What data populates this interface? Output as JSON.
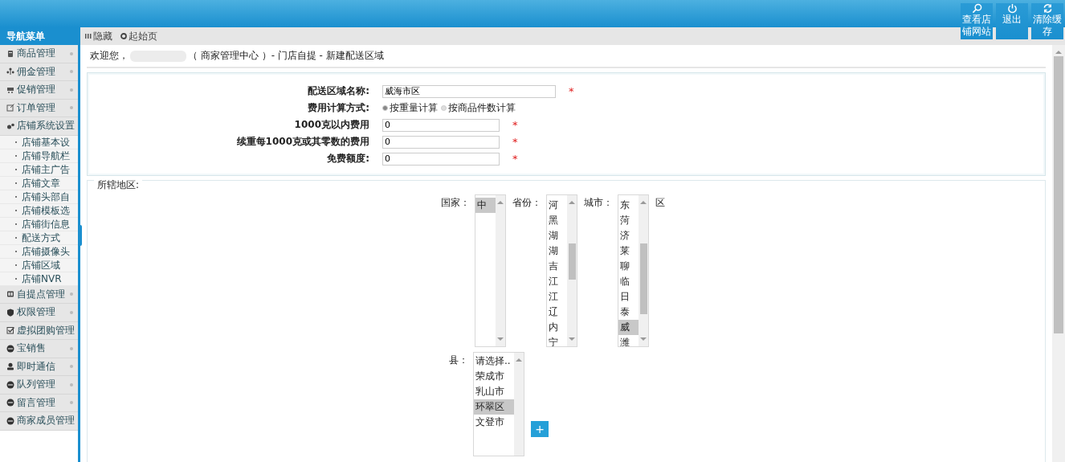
{
  "header": {
    "actions": [
      {
        "label": "查看店铺网站",
        "kind": "search"
      },
      {
        "label": "退出",
        "kind": "power"
      },
      {
        "label": "清除缓存",
        "kind": "refresh"
      }
    ]
  },
  "sidebar": {
    "title": "导航菜单",
    "items": [
      {
        "label": "商品管理",
        "kind": "jar",
        "expanded": false
      },
      {
        "label": "佣金管理",
        "kind": "tree",
        "expanded": false
      },
      {
        "label": "促销管理",
        "kind": "cart",
        "expanded": false
      },
      {
        "label": "订单管理",
        "kind": "edit",
        "expanded": false
      },
      {
        "label": "店铺系统设置",
        "kind": "gears",
        "expanded": true,
        "children": [
          "店铺基本设",
          "店铺导航栏",
          "店铺主广告",
          "店铺文章",
          "店铺头部自",
          "店铺模板选",
          "店铺街信息",
          "配送方式",
          "店铺摄像头",
          "店铺区域",
          "店铺NVR"
        ]
      },
      {
        "label": "自提点管理",
        "kind": "book",
        "expanded": false
      },
      {
        "label": "权限管理",
        "kind": "shield",
        "expanded": false
      },
      {
        "label": "虚拟团购管理",
        "kind": "check",
        "expanded": false
      },
      {
        "label": "宝销售",
        "kind": "minus",
        "expanded": false
      },
      {
        "label": "即时通信",
        "kind": "person",
        "expanded": false
      },
      {
        "label": "队列管理",
        "kind": "minus",
        "expanded": false
      },
      {
        "label": "留言管理",
        "kind": "minus",
        "expanded": false
      },
      {
        "label": "商家成员管理",
        "kind": "minus",
        "expanded": false
      }
    ]
  },
  "toolbar": [
    {
      "label": "隐藏",
      "kind": "bars"
    },
    {
      "label": "起始页",
      "kind": "circle"
    }
  ],
  "breadcrumb": {
    "welcome": "欢迎您，",
    "path": "（ 商家管理中心 ）- 门店自提 - 新建配送区域"
  },
  "form": [
    {
      "label": "配送区域名称:",
      "kind": "text",
      "value": "威海市区",
      "required": "*",
      "wide": true
    },
    {
      "label": "费用计算方式:",
      "kind": "radio",
      "options": [
        {
          "label": "按重量计算",
          "selected": true
        },
        {
          "label": "按商品件数计算",
          "selected": false
        }
      ]
    },
    {
      "label": "1000克以内费用",
      "kind": "text",
      "value": "0",
      "required": "*",
      "wide": false
    },
    {
      "label": "续重每1000克或其零数的费用",
      "kind": "text",
      "value": "0",
      "required": "*",
      "wide": false
    },
    {
      "label": "免费额度:",
      "kind": "text",
      "value": "0",
      "required": "*",
      "wide": false
    }
  ],
  "region": {
    "legend": "所辖地区:",
    "selectors": [
      {
        "label": "国家：",
        "thumb": false,
        "options": [
          {
            "label": "中",
            "selected": true
          }
        ]
      },
      {
        "label": "省份：",
        "thumb": true,
        "options": [
          {
            "label": "河",
            "selected": false
          },
          {
            "label": "黑",
            "selected": false
          },
          {
            "label": "湖",
            "selected": false
          },
          {
            "label": "湖",
            "selected": false
          },
          {
            "label": "吉",
            "selected": false
          },
          {
            "label": "江",
            "selected": false
          },
          {
            "label": "江",
            "selected": false
          },
          {
            "label": "辽",
            "selected": false
          },
          {
            "label": "内",
            "selected": false
          },
          {
            "label": "宁",
            "selected": false
          }
        ]
      },
      {
        "label": "城市：",
        "thumb": true,
        "options": [
          {
            "label": "东",
            "selected": false
          },
          {
            "label": "菏",
            "selected": false
          },
          {
            "label": "济",
            "selected": false
          },
          {
            "label": "莱",
            "selected": false
          },
          {
            "label": "聊",
            "selected": false
          },
          {
            "label": "临",
            "selected": false
          },
          {
            "label": "日",
            "selected": false
          },
          {
            "label": "泰",
            "selected": false
          },
          {
            "label": "威",
            "selected": true
          },
          {
            "label": "潍",
            "selected": false
          }
        ]
      }
    ],
    "district_label": "区",
    "county": {
      "label": "县：",
      "options": [
        {
          "label": "请选择..",
          "selected": false
        },
        {
          "label": "荣成市",
          "selected": false
        },
        {
          "label": "乳山市",
          "selected": false
        },
        {
          "label": "环翠区",
          "selected": true
        },
        {
          "label": "文登市",
          "selected": false
        }
      ]
    },
    "add_button": "+"
  }
}
